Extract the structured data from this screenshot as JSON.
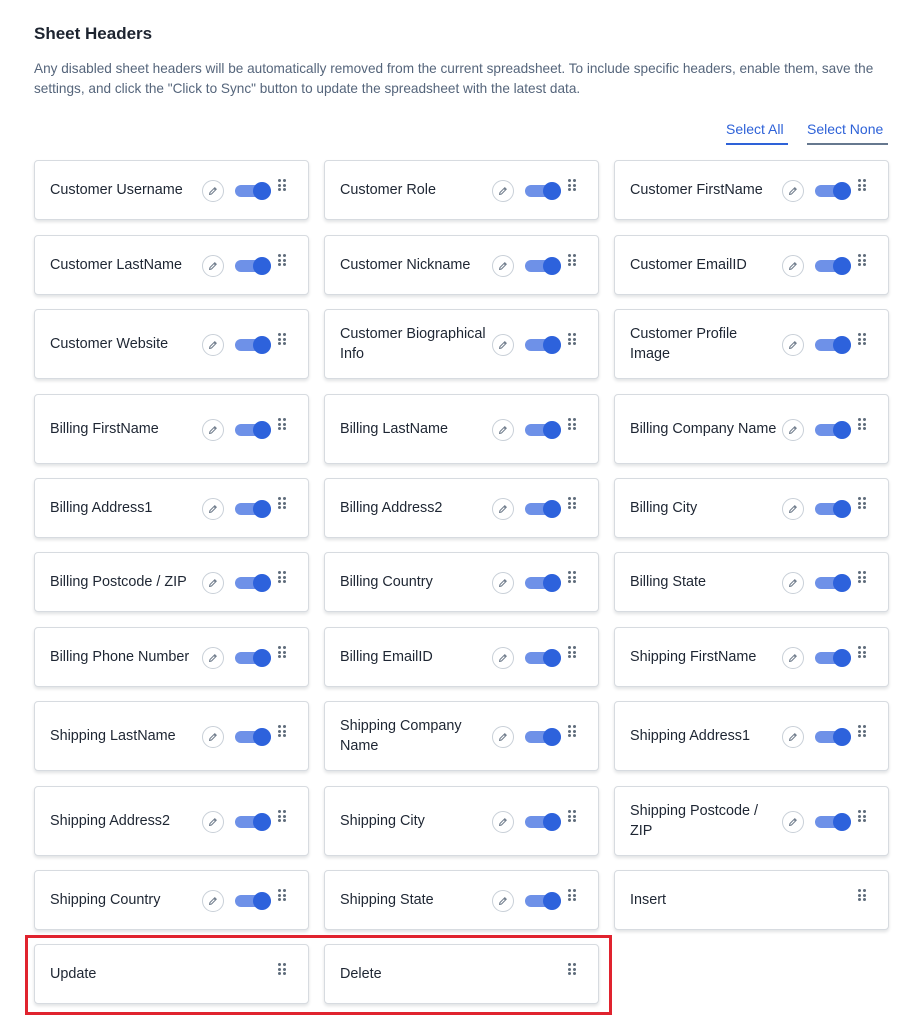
{
  "section": {
    "title": "Sheet Headers",
    "description": "Any disabled sheet headers will be automatically removed from the current spreadsheet. To include specific headers, enable them, save the settings, and click the \"Click to Sync\" button to update the spreadsheet with the latest data."
  },
  "actions": {
    "select_all": "Select All",
    "select_none": "Select None"
  },
  "colors": {
    "accent": "#2e62d8",
    "toggle_track": "#6e91e8",
    "highlight": "#e0232e"
  },
  "icons": {
    "edit": "pencil-icon",
    "toggle": "toggle-switch",
    "drag": "drag-handle-icon"
  },
  "headers": [
    {
      "label": "Customer Username",
      "enabled": true,
      "editable": true
    },
    {
      "label": "Customer Role",
      "enabled": true,
      "editable": true
    },
    {
      "label": "Customer FirstName",
      "enabled": true,
      "editable": true
    },
    {
      "label": "Customer LastName",
      "enabled": true,
      "editable": true
    },
    {
      "label": "Customer Nickname",
      "enabled": true,
      "editable": true
    },
    {
      "label": "Customer EmailID",
      "enabled": true,
      "editable": true
    },
    {
      "label": "Customer Website",
      "enabled": true,
      "editable": true
    },
    {
      "label": "Customer Biographical Info",
      "enabled": true,
      "editable": true
    },
    {
      "label": "Customer Profile Image",
      "enabled": true,
      "editable": true
    },
    {
      "label": "Billing FirstName",
      "enabled": true,
      "editable": true
    },
    {
      "label": "Billing LastName",
      "enabled": true,
      "editable": true
    },
    {
      "label": "Billing Company Name",
      "enabled": true,
      "editable": true
    },
    {
      "label": "Billing Address1",
      "enabled": true,
      "editable": true
    },
    {
      "label": "Billing Address2",
      "enabled": true,
      "editable": true
    },
    {
      "label": "Billing City",
      "enabled": true,
      "editable": true
    },
    {
      "label": "Billing Postcode / ZIP",
      "enabled": true,
      "editable": true
    },
    {
      "label": "Billing Country",
      "enabled": true,
      "editable": true
    },
    {
      "label": "Billing State",
      "enabled": true,
      "editable": true
    },
    {
      "label": "Billing Phone Number",
      "enabled": true,
      "editable": true
    },
    {
      "label": "Billing EmailID",
      "enabled": true,
      "editable": true
    },
    {
      "label": "Shipping FirstName",
      "enabled": true,
      "editable": true
    },
    {
      "label": "Shipping LastName",
      "enabled": true,
      "editable": true
    },
    {
      "label": "Shipping Company Name",
      "enabled": true,
      "editable": true
    },
    {
      "label": "Shipping Address1",
      "enabled": true,
      "editable": true
    },
    {
      "label": "Shipping Address2",
      "enabled": true,
      "editable": true
    },
    {
      "label": "Shipping City",
      "enabled": true,
      "editable": true
    },
    {
      "label": "Shipping Postcode / ZIP",
      "enabled": true,
      "editable": true
    },
    {
      "label": "Shipping Country",
      "enabled": true,
      "editable": true
    },
    {
      "label": "Shipping State",
      "enabled": true,
      "editable": true
    },
    {
      "label": "Insert",
      "enabled": null,
      "editable": false
    },
    {
      "label": "Update",
      "enabled": null,
      "editable": false
    },
    {
      "label": "Delete",
      "enabled": null,
      "editable": false
    }
  ]
}
